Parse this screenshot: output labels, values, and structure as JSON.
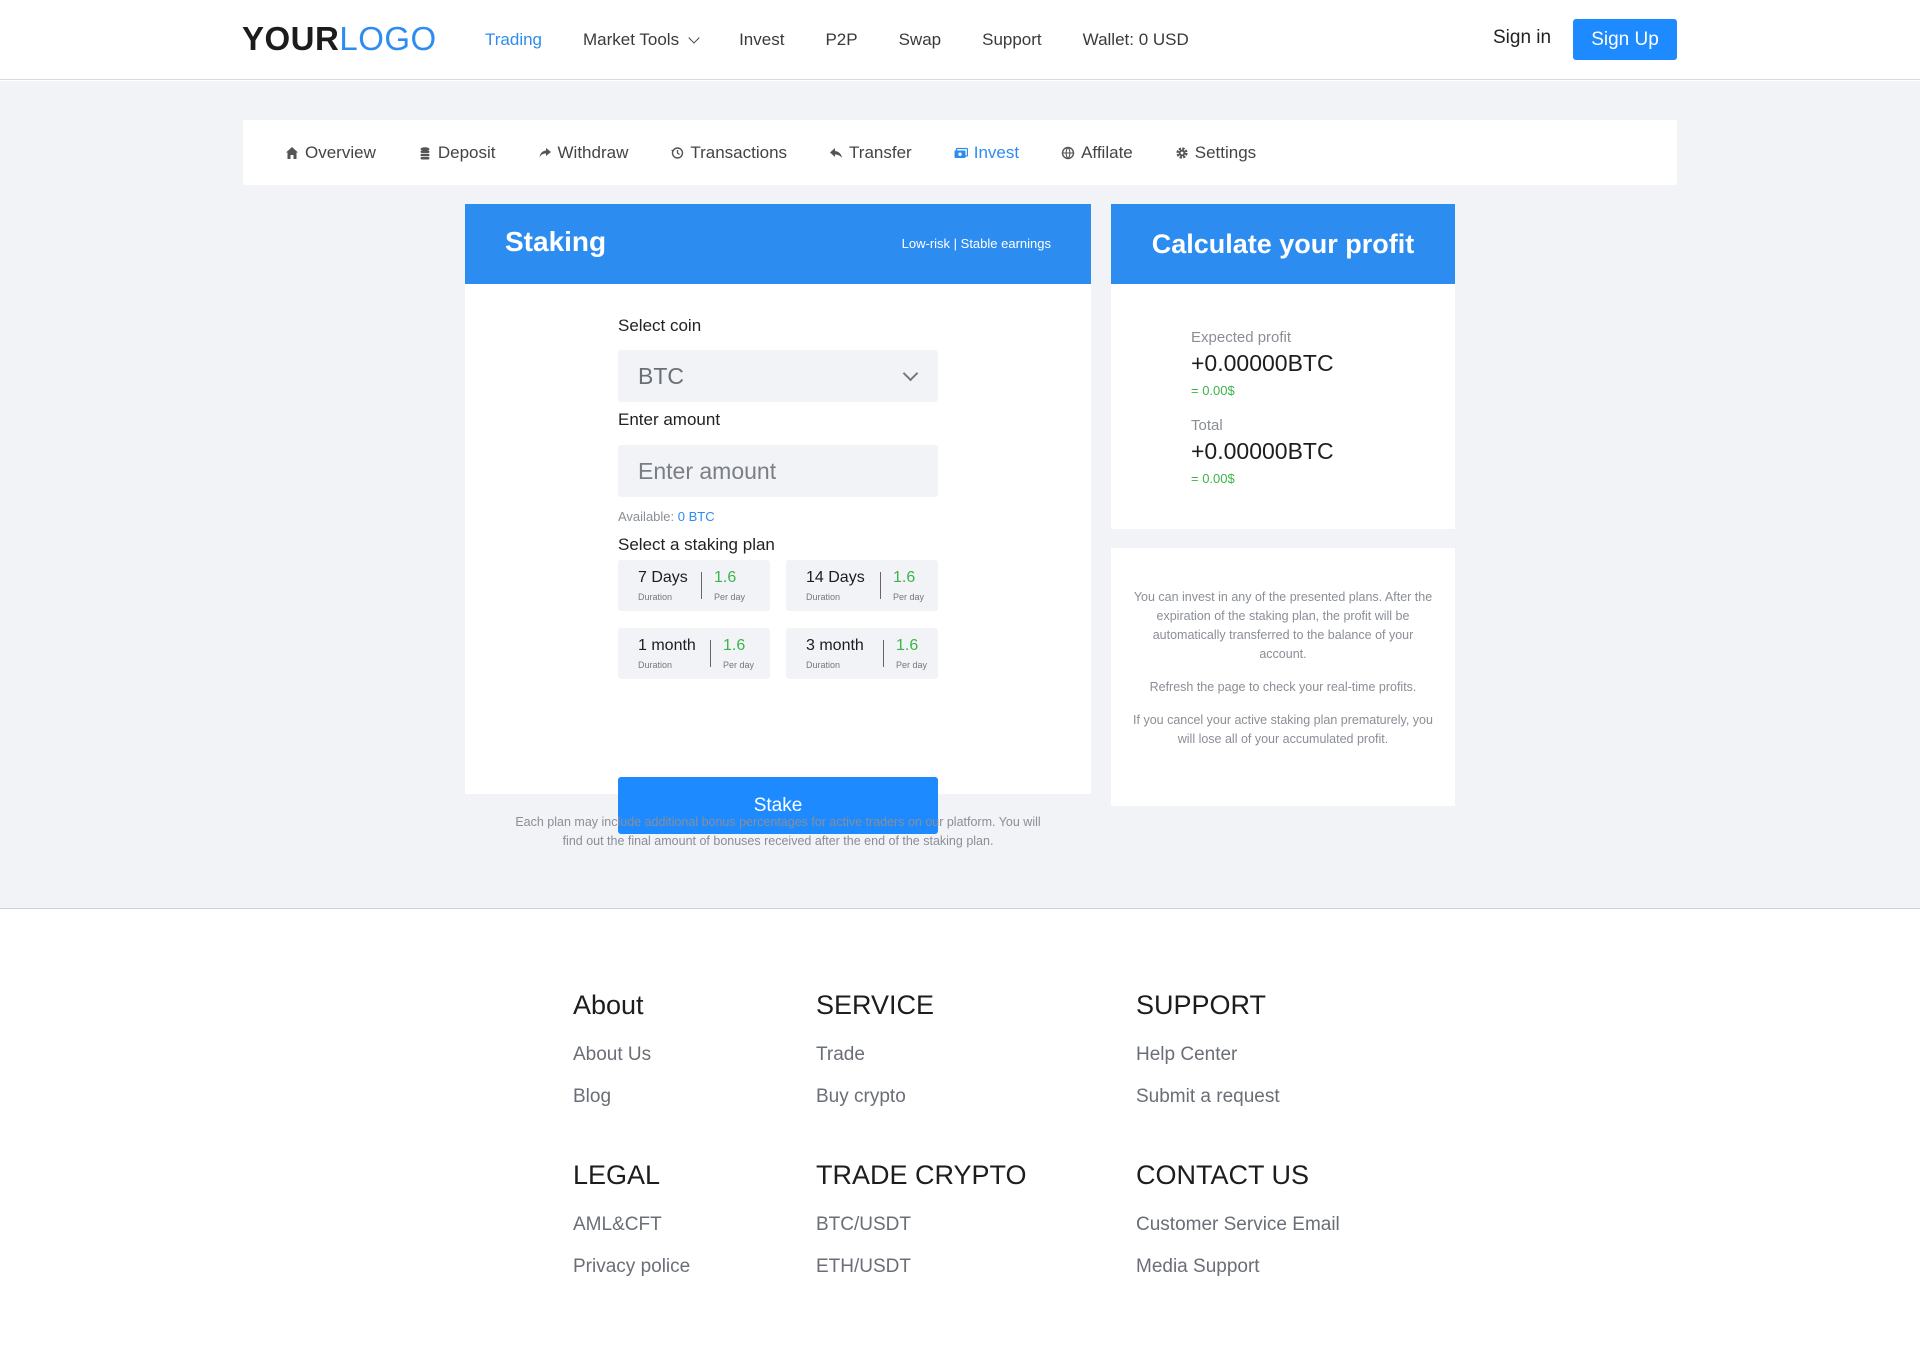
{
  "header": {
    "logo_part1": "YOUR",
    "logo_part2": "LOGO",
    "nav": [
      {
        "label": "Trading"
      },
      {
        "label": "Market Tools"
      },
      {
        "label": "Invest"
      },
      {
        "label": "P2P"
      },
      {
        "label": "Swap"
      },
      {
        "label": "Support"
      },
      {
        "label": "Wallet: 0 USD"
      }
    ],
    "sign_in": "Sign in",
    "sign_up": "Sign Up"
  },
  "tabs": [
    {
      "label": "Overview",
      "icon": "home-icon"
    },
    {
      "label": "Deposit",
      "icon": "coins-icon"
    },
    {
      "label": "Withdraw",
      "icon": "share-icon"
    },
    {
      "label": "Transactions",
      "icon": "history-icon"
    },
    {
      "label": "Transfer",
      "icon": "reply-icon"
    },
    {
      "label": "Invest",
      "icon": "money-icon"
    },
    {
      "label": "Affilate",
      "icon": "network-icon"
    },
    {
      "label": "Settings",
      "icon": "gear-icon"
    }
  ],
  "staking": {
    "title": "Staking",
    "subtitle": "Low-risk | Stable earnings",
    "select_coin_label": "Select coin",
    "selected_coin": "BTC",
    "amount_label": "Enter amount",
    "amount_placeholder": "Enter amount",
    "available_label": "Available:",
    "available_value": "0 BTC",
    "plan_label": "Select a staking plan",
    "plans": [
      {
        "duration": "7 Days",
        "duration_label": "Duration",
        "rate": "1.6",
        "rate_label": "Per day"
      },
      {
        "duration": "14 Days",
        "duration_label": "Duration",
        "rate": "1.6",
        "rate_label": "Per day"
      },
      {
        "duration": "1 month",
        "duration_label": "Duration",
        "rate": "1.6",
        "rate_label": "Per day"
      },
      {
        "duration": "3 month",
        "duration_label": "Duration",
        "rate": "1.6",
        "rate_label": "Per day"
      }
    ],
    "stake_button": "Stake",
    "note": "Each plan may include additional bonus percentages for active traders on our platform. You will find out the final amount of bonuses received after the end of the staking plan."
  },
  "calculator": {
    "title": "Calculate your profit",
    "expected_label": "Expected profit",
    "expected_value": "+0.00000BTC",
    "expected_usd": "= 0.00$",
    "total_label": "Total",
    "total_value": "+0.00000BTC",
    "total_usd": "= 0.00$",
    "info": [
      "You can invest in any of the presented plans. After the expiration of the staking plan, the profit will be automatically transferred to the balance of your account.",
      "Refresh the page to check your real-time profits.",
      "If you cancel your active staking plan prematurely, you will lose all of your accumulated profit."
    ]
  },
  "footer": {
    "about": {
      "title": "About",
      "links": [
        "About Us",
        "Blog"
      ]
    },
    "service": {
      "title": "SERVICE",
      "links": [
        "Trade",
        "Buy crypto"
      ]
    },
    "support": {
      "title": "SUPPORT",
      "links": [
        "Help Center",
        "Submit a request"
      ]
    },
    "legal": {
      "title": "LEGAL",
      "links": [
        "AML&CFT",
        "Privacy police"
      ]
    },
    "trade": {
      "title": "TRADE CRYPTO",
      "links": [
        "BTC/USDT",
        "ETH/USDT"
      ]
    },
    "contact": {
      "title": "CONTACT US",
      "links": [
        "Customer Service Email",
        "Media Support"
      ]
    }
  },
  "colors": {
    "accent": "#2d8cf0",
    "button": "#1e8aff",
    "positive": "#3ab54a",
    "background": "#f2f3f7"
  }
}
